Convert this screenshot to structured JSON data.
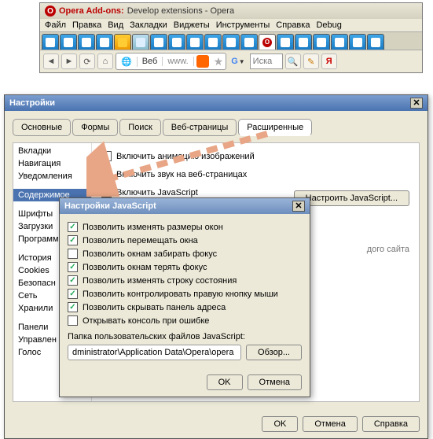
{
  "browser": {
    "title_prefix": "Opera Add-ons:",
    "title_main": "Develop extensions - Opera",
    "menu": [
      "Файл",
      "Правка",
      "Вид",
      "Закладки",
      "Виджеты",
      "Инструменты",
      "Справка",
      "Debug"
    ],
    "addr_web": "Веб",
    "addr_www": "www.",
    "search_placeholder": "Иска"
  },
  "settings": {
    "title": "Настройки",
    "tabs": [
      "Основные",
      "Формы",
      "Поиск",
      "Веб-страницы",
      "Расширенные"
    ],
    "side": [
      "Вкладки",
      "Навигация",
      "Уведомления",
      "",
      "Содержимое",
      "",
      "Шрифты",
      "Загрузки",
      "Программы",
      "",
      "История",
      "Cookies",
      "Безопасн",
      "Сеть",
      "Хранили",
      "",
      "Панели",
      "Управлен",
      "Голос"
    ],
    "chk_anim": "Включить анимацию изображений",
    "chk_sound": "Включить звук на веб-страницах",
    "chk_js": "Включить JavaScript",
    "btn_js": "Настроить JavaScript...",
    "note": "дого сайта",
    "ok": "OK",
    "cancel": "Отмена",
    "help": "Справка"
  },
  "js": {
    "title": "Настройки JavaScript",
    "opts": [
      {
        "c": true,
        "t": "Позволить изменять размеры окон"
      },
      {
        "c": true,
        "t": "Позволить перемещать окна"
      },
      {
        "c": false,
        "t": "Позволить окнам забирать фокус"
      },
      {
        "c": true,
        "t": "Позволить окнам терять фокус"
      },
      {
        "c": true,
        "t": "Позволить изменять строку состояния"
      },
      {
        "c": true,
        "t": "Позволить контролировать правую кнопку мыши"
      },
      {
        "c": true,
        "t": "Позволить скрывать панель адреса"
      },
      {
        "c": false,
        "t": "Открывать консоль при ошибке"
      }
    ],
    "folder_label": "Папка пользовательских файлов JavaScript:",
    "folder_path": "dministrator\\Application Data\\Opera\\opera",
    "browse": "Обзор...",
    "ok": "OK",
    "cancel": "Отмена"
  }
}
